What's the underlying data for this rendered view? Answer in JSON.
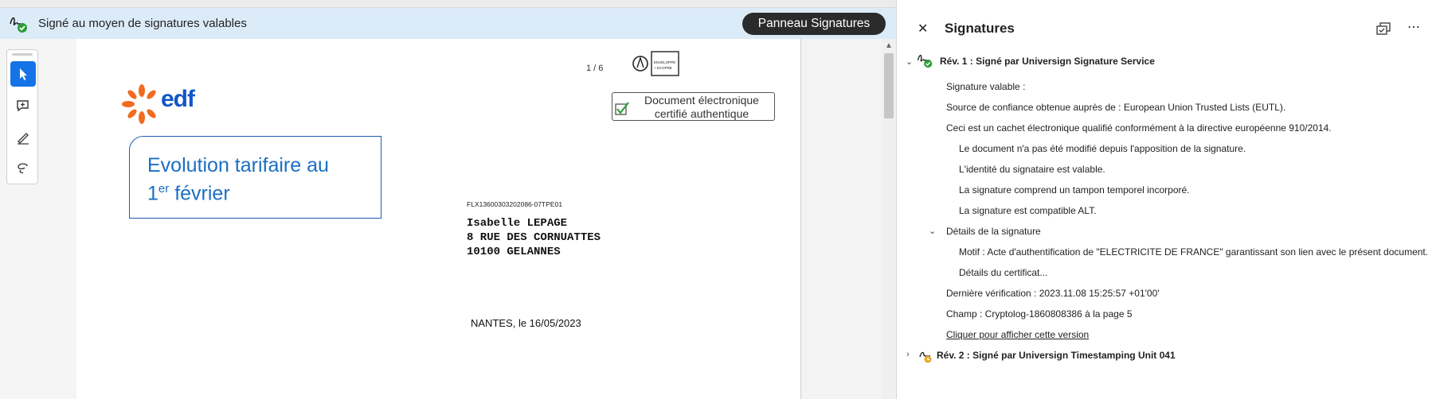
{
  "sigbar": {
    "message": "Signé au moyen de signatures valables",
    "panel_button": "Panneau Signatures"
  },
  "tools": {
    "select": "select-tool",
    "comment": "comment-tool",
    "draw": "draw-tool",
    "lasso": "lasso-tool"
  },
  "document": {
    "page_indicator": "1 / 6",
    "logo_text": "edf",
    "title_line1": "Evolution tarifaire au",
    "title_line2_num": "1",
    "title_line2_sup": "er",
    "title_line2_rest": " février",
    "cert_badge_line1": "Document électronique",
    "cert_badge_line2": "certifié authentique",
    "reference": "FLX13600303202086-07TPE01",
    "address": [
      "Isabelle LEPAGE",
      "8 RUE DES CORNUATTES",
      "10100 GELANNES"
    ],
    "place_date": "NANTES, le 16/05/2023",
    "envelope_text1": "ENVELOPPE",
    "envelope_text2": "+ ECOPRE"
  },
  "panel": {
    "title": "Signatures",
    "rev1": {
      "header": "Rév. 1 : Signé par Universign Signature Service",
      "valid": "Signature valable :",
      "source": "Source de confiance obtenue auprès de : European Union Trusted Lists (EUTL).",
      "qualified": "Ceci est un cachet électronique qualifié conformément à la directive européenne 910/2014.",
      "not_modified": "Le document n'a pas été modifié depuis l'apposition de la signature.",
      "identity": "L'identité du signataire est valable.",
      "timestamp": "La signature comprend un tampon temporel incorporé.",
      "alt": "La signature est compatible ALT.",
      "details": "Détails de la signature",
      "motif": "Motif : Acte d'authentification de \"ELECTRICITE  DE FRANCE\" garantissant son lien avec le présent document.",
      "cert_details": "Détails du certificat...",
      "last_verif": "Dernière vérification : 2023.11.08 15:25:57 +01'00'",
      "field": "Champ : Cryptolog-1860808386 à la page 5",
      "link": "Cliquer pour afficher cette version"
    },
    "rev2": {
      "header": "Rév. 2 : Signé par Universign Timestamping Unit 041"
    }
  },
  "colors": {
    "accent": "#1473e6",
    "banner": "#dcebf8",
    "edf_blue": "#1057c8",
    "edf_orange": "#f26b21",
    "valid_green": "#2d9d3a"
  }
}
